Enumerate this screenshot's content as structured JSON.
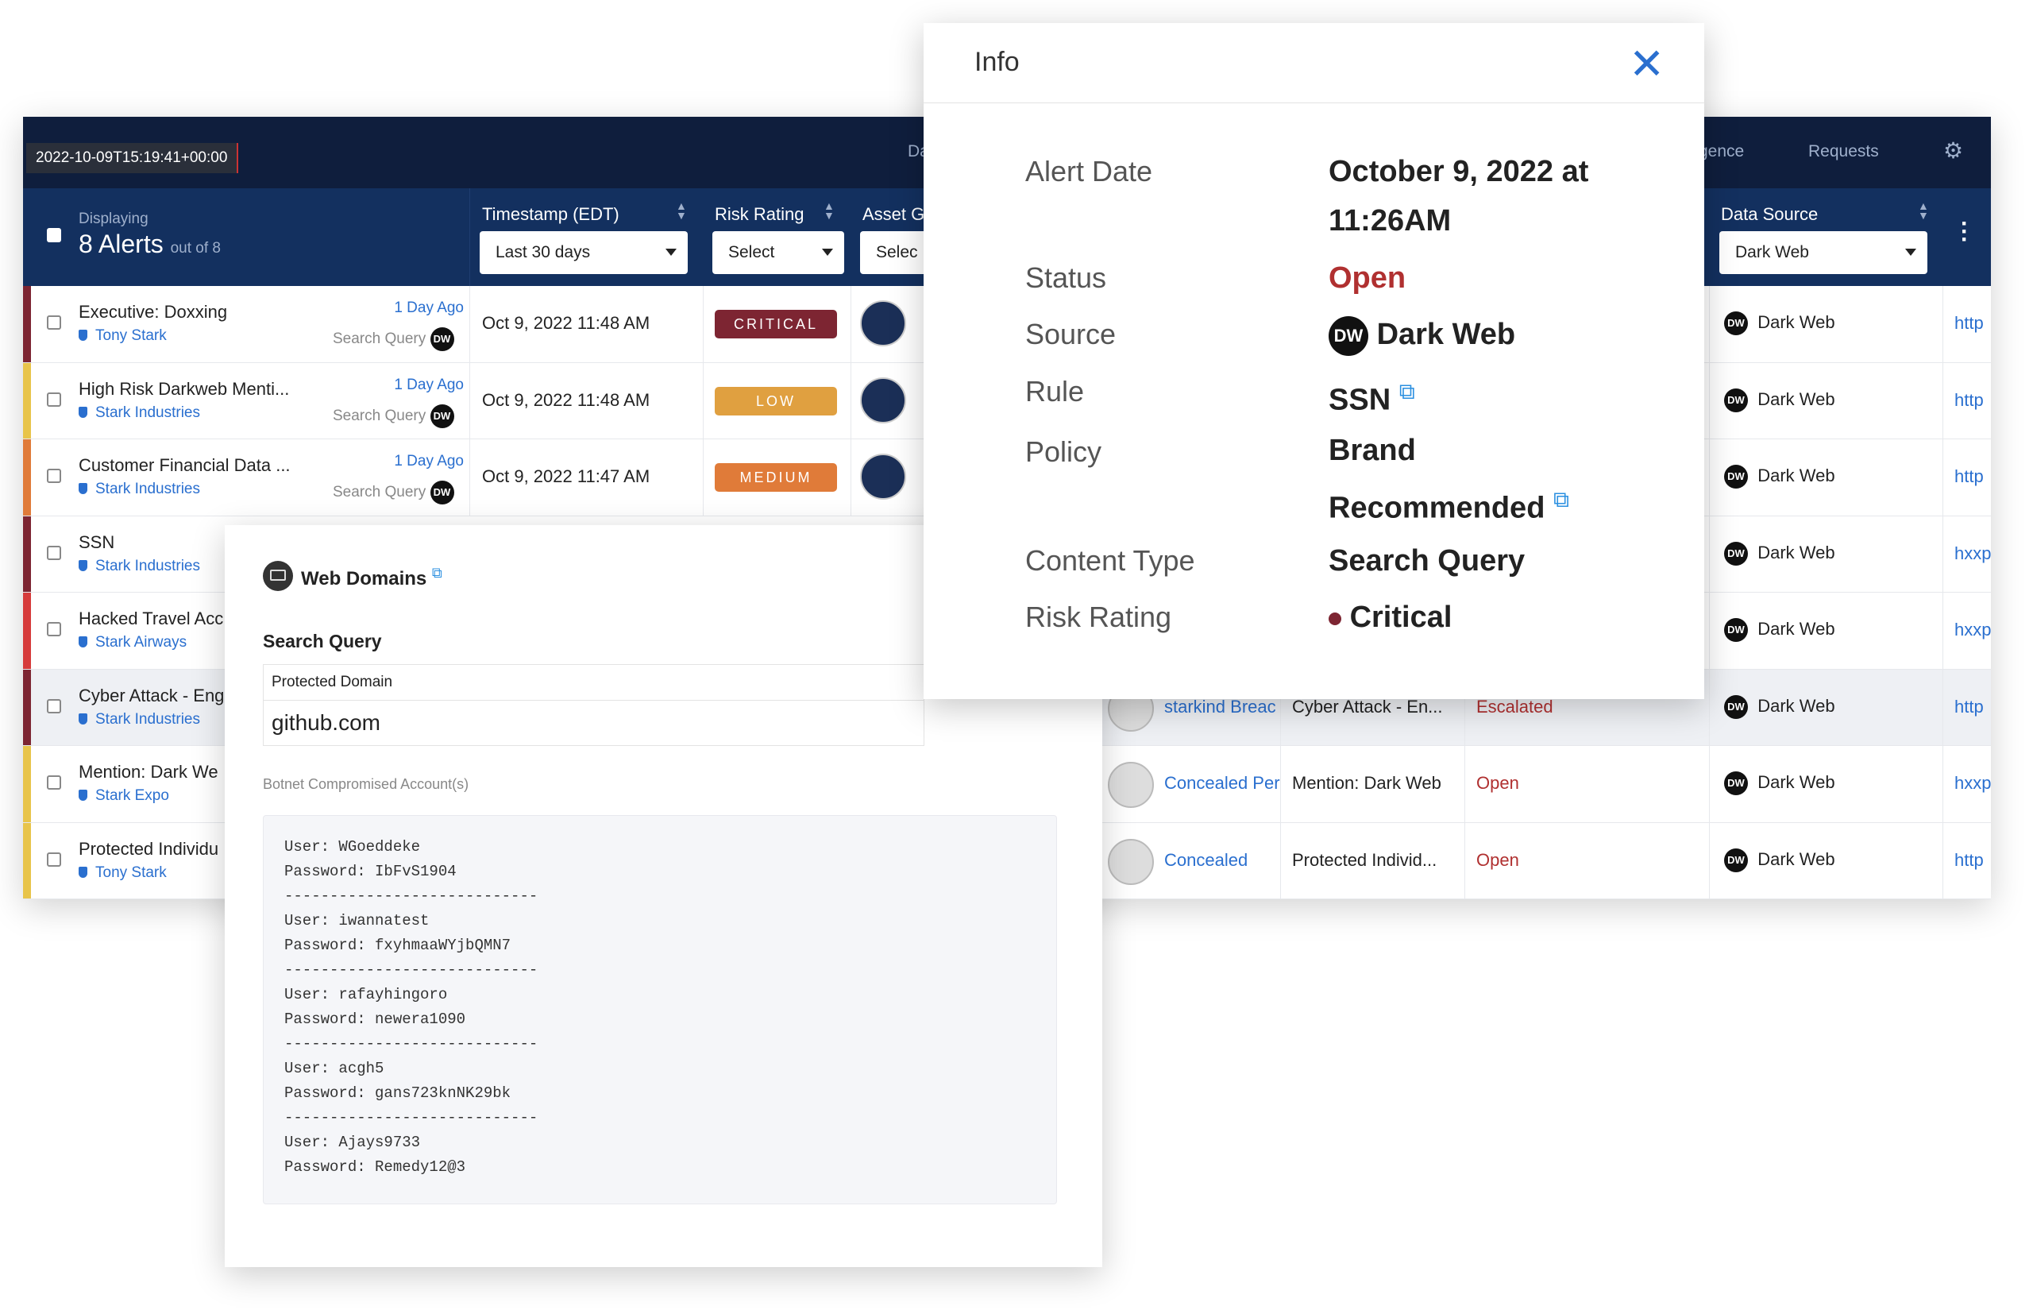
{
  "app": {
    "timestamp_tooltip": "2022-10-09T15:19:41+00:00",
    "nav": {
      "partial_left": "Da",
      "partial_intel": "gence",
      "requests": "Requests",
      "settings_icon": "gear-icon"
    }
  },
  "header": {
    "displaying": "Displaying",
    "count": "8 Alerts",
    "out_of": "out of 8",
    "timestamp": {
      "label": "Timestamp (EDT)",
      "filter": "Last 30 days"
    },
    "risk": {
      "label": "Risk Rating",
      "filter": "Select"
    },
    "asset": {
      "label": "Asset G",
      "filter": "Selec"
    },
    "data_source": {
      "label": "Data Source",
      "filter": "Dark Web"
    }
  },
  "colors": {
    "critical": "#7d2532",
    "low": "#e0a040",
    "medium": "#e07b39",
    "high": "#d63b3b",
    "yellow": "#e8c44a",
    "link": "#2a6fcf",
    "open": "#b03030"
  },
  "rows": [
    {
      "title": "Executive: Doxxing",
      "org": "Tony Stark",
      "ago": "1 Day Ago",
      "type": "Search Query",
      "ts": "Oct 9, 2022  11:48 AM",
      "risk": "CRITICAL",
      "ds": "Dark Web",
      "url": "http"
    },
    {
      "title": "High Risk Darkweb Menti...",
      "org": "Stark Industries",
      "ago": "1 Day Ago",
      "type": "Search Query",
      "ts": "Oct 9, 2022  11:48 AM",
      "risk": "LOW",
      "ds": "Dark Web",
      "url": "http"
    },
    {
      "title": "Customer Financial Data ...",
      "org": "Stark Industries",
      "ago": "1 Day Ago",
      "type": "Search Query",
      "ts": "Oct 9, 2022  11:47 AM",
      "risk": "MEDIUM",
      "ds": "Dark Web",
      "url": "http"
    },
    {
      "title": "SSN",
      "org": "Stark Industries",
      "ds": "Dark Web",
      "url": "hxxp"
    },
    {
      "title": "Hacked Travel Acc",
      "org": "Stark Airways",
      "ds": "Dark Web",
      "url": "hxxp"
    },
    {
      "title": "Cyber Attack - Eng",
      "org": "Stark Industries",
      "person": "starkind Breac",
      "alert": "Cyber Attack - En...",
      "status": "Escalated",
      "ds": "Dark Web",
      "url": "http"
    },
    {
      "title": "Mention: Dark We",
      "org": "Stark Expo",
      "person": "Concealed Per",
      "alert": "Mention: Dark Web",
      "status": "Open",
      "ds": "Dark Web",
      "url": "hxxp"
    },
    {
      "title": "Protected Individu",
      "org": "Tony Stark",
      "person": "Concealed",
      "alert": "Protected Individ...",
      "status": "Open",
      "ds": "Dark Web",
      "url": "http"
    }
  ],
  "info": {
    "title": "Info",
    "fields": {
      "alert_date": {
        "label": "Alert Date",
        "value1": "October 9, 2022 at",
        "value2": "11:26AM"
      },
      "status": {
        "label": "Status",
        "value": "Open"
      },
      "source": {
        "label": "Source",
        "value": "Dark Web",
        "badge": "DW"
      },
      "rule": {
        "label": "Rule",
        "value": "SSN"
      },
      "policy": {
        "label": "Policy",
        "value1": "Brand",
        "value2": "Recommended"
      },
      "content_type": {
        "label": "Content Type",
        "value": "Search Query"
      },
      "risk_rating": {
        "label": "Risk Rating",
        "value": "Critical"
      }
    }
  },
  "web_domains": {
    "title": "Web Domains",
    "section": "Search Query",
    "field_label": "Protected Domain",
    "field_value": "github.com",
    "botnet_label": "Botnet Compromised Account(s)",
    "accounts": "User: WGoeddeke\nPassword: IbFvS1904\n----------------------------\nUser: iwannatest\nPassword: fxyhmaaWYjbQMN7\n----------------------------\nUser: rafayhingoro\nPassword: newera1090\n----------------------------\nUser: acgh5\nPassword: gans723knNK29bk\n----------------------------\nUser: Ajays9733\nPassword: Remedy12@3"
  }
}
